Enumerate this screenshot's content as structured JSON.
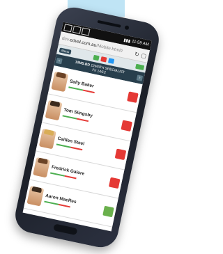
{
  "statusbar": {
    "time": "11:59 AM"
  },
  "browser": {
    "url_prefix": "dev.",
    "url_domain": "edval.com.au",
    "url_path": "/Mobile.html#"
  },
  "toolbar": {
    "menu_label": "Menu",
    "pills": [
      {
        "color": "#4caf50"
      },
      {
        "color": "#e53935"
      },
      {
        "color": "#2196f3"
      }
    ],
    "right_label": ""
  },
  "class_header": {
    "class_code": "12MS.BD",
    "class_name": "12MATH SPECIALIST",
    "period": "Fri 14/12"
  },
  "students": [
    {
      "name": "Sally Baker",
      "status_color": "#e53935",
      "hair": ""
    },
    {
      "name": "Tom Slingsby",
      "status_color": "#e53935",
      "hair": "dark"
    },
    {
      "name": "Caitlen Steel",
      "status_color": "#e53935",
      "hair": "blonde"
    },
    {
      "name": "Fredrick Galore",
      "status_color": "#e53935",
      "hair": ""
    },
    {
      "name": "Aaron MacRes",
      "status_color": "#6ab04c",
      "hair": "dark"
    }
  ],
  "colors": {
    "phone_body": "#1f2430",
    "header_bg": "#283f4d",
    "accent_blue": "#bfe4f5"
  }
}
